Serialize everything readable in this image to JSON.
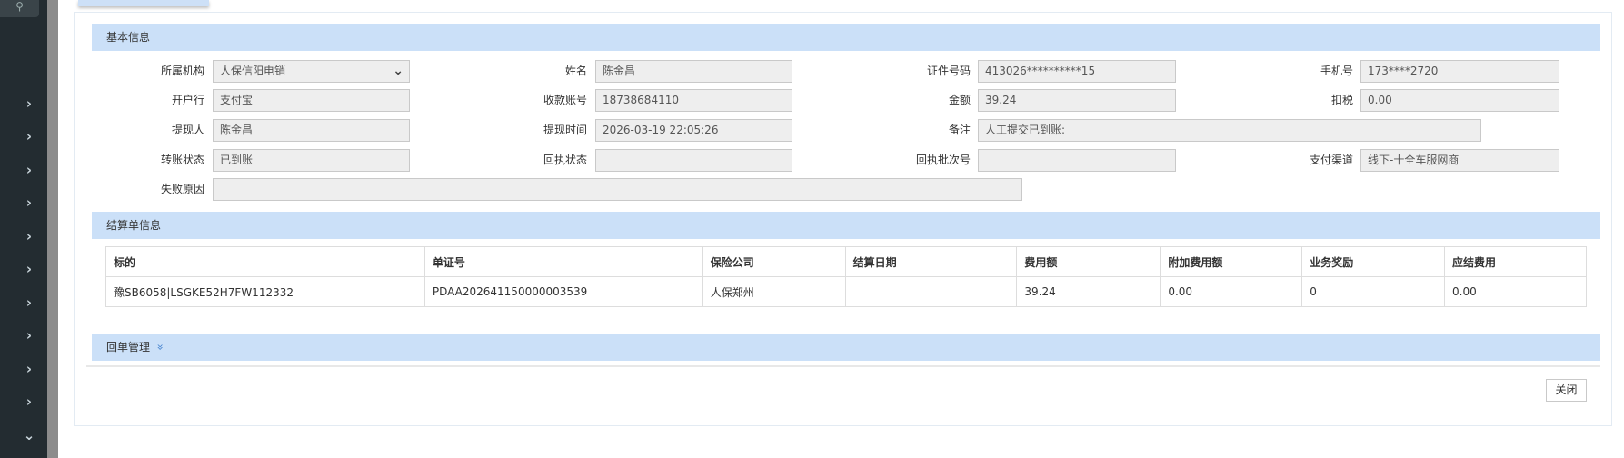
{
  "sidebar": {
    "search_icon": "search-icon",
    "chevrons": 10
  },
  "basic": {
    "title": "基本信息",
    "fields": [
      {
        "label": "所属机构",
        "value": "人保信阳电销",
        "type": "select"
      },
      {
        "label": "姓名",
        "value": "陈金昌"
      },
      {
        "label": "证件号码",
        "value": "413026**********15"
      },
      {
        "label": "手机号",
        "value": "173****2720"
      },
      {
        "label": "开户行",
        "value": "支付宝"
      },
      {
        "label": "收款账号",
        "value": "18738684110"
      },
      {
        "label": "金额",
        "value": "39.24"
      },
      {
        "label": "扣税",
        "value": "0.00"
      },
      {
        "label": "提现人",
        "value": "陈金昌"
      },
      {
        "label": "提现时间",
        "value": "2026-03-19 22:05:26"
      },
      {
        "label": "备注",
        "value": "人工提交已到账:"
      },
      {
        "label": "转账状态",
        "value": "已到账"
      },
      {
        "label": "回执状态",
        "value": ""
      },
      {
        "label": "回执批次号",
        "value": ""
      },
      {
        "label": "支付渠道",
        "value": "线下-十全车服网商"
      },
      {
        "label": "失败原因",
        "value": ""
      }
    ]
  },
  "settlement": {
    "title": "结算单信息",
    "columns": [
      "标的",
      "单证号",
      "保险公司",
      "结算日期",
      "费用额",
      "附加费用额",
      "业务奖励",
      "应结费用"
    ],
    "rows": [
      [
        "豫SB6058|LSGKE52H7FW112332",
        "PDAA202641150000003539",
        "人保郑州",
        "",
        "39.24",
        "0.00",
        "0",
        "0.00"
      ]
    ]
  },
  "receipt": {
    "title": "回单管理",
    "toggle_icon": "double-chevron-down-icon"
  },
  "footer": {
    "close_label": "关闭"
  }
}
